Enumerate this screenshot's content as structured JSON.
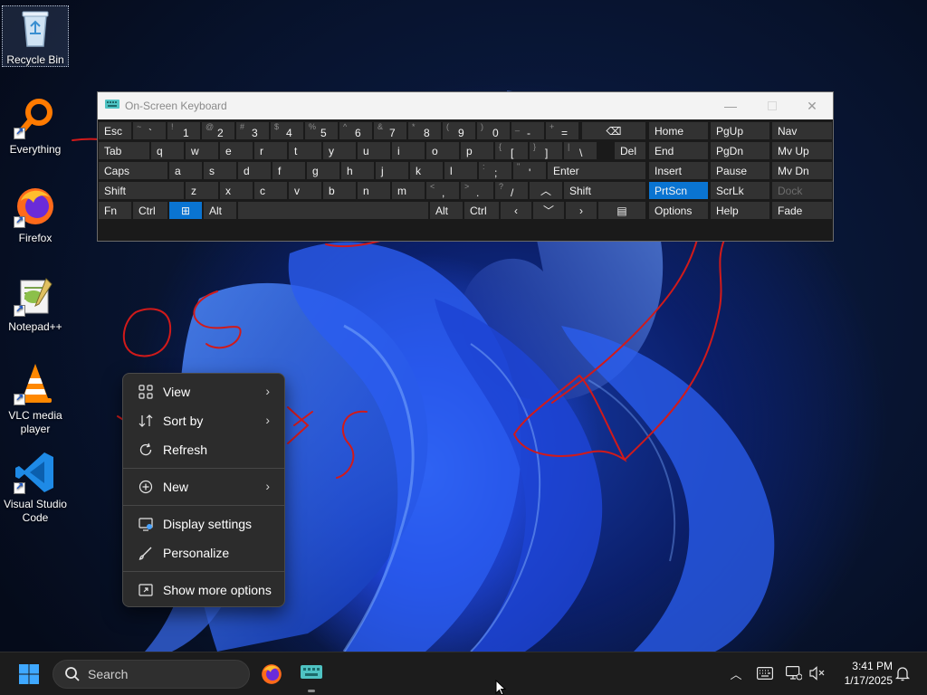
{
  "desktop": {
    "icons": [
      {
        "label": "Recycle Bin"
      },
      {
        "label": "Everything"
      },
      {
        "label": "Firefox"
      },
      {
        "label": "Notepad++"
      },
      {
        "label": "VLC media player"
      },
      {
        "label": "Visual Studio Code"
      }
    ]
  },
  "osk": {
    "title": "On-Screen Keyboard",
    "row1": [
      {
        "main": "Esc"
      },
      {
        "sub": "~",
        "main": "`"
      },
      {
        "sub": "!",
        "main": "1"
      },
      {
        "sub": "@",
        "main": "2"
      },
      {
        "sub": "#",
        "main": "3"
      },
      {
        "sub": "$",
        "main": "4"
      },
      {
        "sub": "%",
        "main": "5"
      },
      {
        "sub": "^",
        "main": "6"
      },
      {
        "sub": "&",
        "main": "7"
      },
      {
        "sub": "*",
        "main": "8"
      },
      {
        "sub": "(",
        "main": "9"
      },
      {
        "sub": ")",
        "main": "0"
      },
      {
        "sub": "_",
        "main": "-"
      },
      {
        "sub": "+",
        "main": "="
      }
    ],
    "row2": [
      "Tab",
      "q",
      "w",
      "e",
      "r",
      "t",
      "y",
      "u",
      "i",
      "o",
      "p"
    ],
    "row2_brackets": [
      {
        "sub": "{",
        "main": "["
      },
      {
        "sub": "}",
        "main": "]"
      },
      {
        "sub": "|",
        "main": "\\"
      }
    ],
    "row2_del": "Del",
    "row3": [
      "Caps",
      "a",
      "s",
      "d",
      "f",
      "g",
      "h",
      "j",
      "k",
      "l"
    ],
    "row3_punct": [
      {
        "sub": ":",
        "main": ";"
      },
      {
        "sub": "\"",
        "main": "'"
      }
    ],
    "row3_enter": "Enter",
    "row4": [
      "Shift",
      "z",
      "x",
      "c",
      "v",
      "b",
      "n",
      "m"
    ],
    "row4_punct": [
      {
        "sub": "<",
        "main": ","
      },
      {
        "sub": ">",
        "main": "."
      },
      {
        "sub": "?",
        "main": "/"
      }
    ],
    "row4_shift_r": "Shift",
    "row5": {
      "fn": "Fn",
      "ctrl": "Ctrl",
      "alt": "Alt",
      "alt_r": "Alt",
      "ctrl_r": "Ctrl"
    },
    "nav_keys": [
      [
        "Home",
        "PgUp",
        "Nav"
      ],
      [
        "End",
        "PgDn",
        "Mv Up"
      ],
      [
        "Insert",
        "Pause",
        "Mv Dn"
      ],
      [
        "PrtScn",
        "ScrLk",
        "Dock"
      ],
      [
        "Options",
        "Help",
        "Fade"
      ]
    ]
  },
  "context_menu": {
    "items": [
      {
        "label": "View",
        "icon": "grid-icon",
        "submenu": true
      },
      {
        "label": "Sort by",
        "icon": "sort-icon",
        "submenu": true
      },
      {
        "label": "Refresh",
        "icon": "refresh-icon",
        "submenu": false
      },
      {
        "label": "New",
        "icon": "plus-circle-icon",
        "submenu": true
      },
      {
        "label": "Display settings",
        "icon": "display-icon",
        "submenu": false
      },
      {
        "label": "Personalize",
        "icon": "brush-icon",
        "submenu": false
      },
      {
        "label": "Show more options",
        "icon": "expand-icon",
        "submenu": false
      }
    ]
  },
  "taskbar": {
    "search_placeholder": "Search",
    "clock": {
      "time": "3:41 PM",
      "date": "1/17/2025"
    }
  },
  "colors": {
    "accent": "#0a74d1",
    "ink": "#d11a1a",
    "taskbar": "#1c1c1c"
  }
}
